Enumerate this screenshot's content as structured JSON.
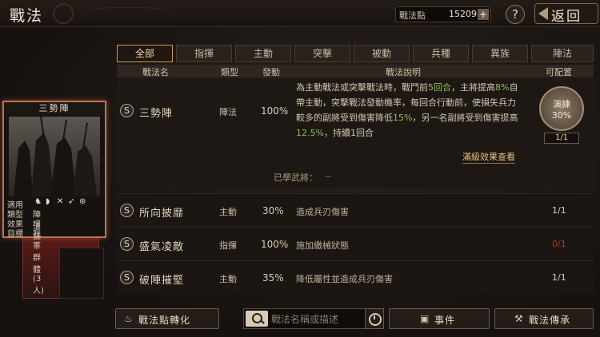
{
  "header": {
    "title": "戰法",
    "points_label": "戰法點",
    "points_value": "15209",
    "plus_label": "+",
    "help_label": "?",
    "back_label": "返回"
  },
  "tabs": [
    {
      "label": "全部",
      "active": true
    },
    {
      "label": "指揮"
    },
    {
      "label": "主動"
    },
    {
      "label": "突擊"
    },
    {
      "label": "被動"
    },
    {
      "label": "兵種"
    },
    {
      "label": "異族"
    },
    {
      "label": "陣法"
    }
  ],
  "table": {
    "headers": [
      "戰法名",
      "類型",
      "發動",
      "戰法說明",
      "可配置"
    ]
  },
  "featured": {
    "badge": "S",
    "name": "三勢陣",
    "type": "陣法",
    "rate": "100%",
    "desc_parts": [
      "為主動戰法或突擊戰法時，戰鬥前",
      "5回合",
      "，主將提高",
      "8%",
      "自帶主動，突擊戰法發動機率，每回合行動前，使損失兵力較多的副將受到傷害降低",
      "15%",
      "，另一名副將受到傷害提高",
      "12.5%",
      "，持續1回合"
    ],
    "full_effect_link": "滿級效果查看",
    "learned_label": "已學武將：",
    "learned_value": "--",
    "train_label": "演練",
    "train_pct": "30%",
    "train_count": "1/1"
  },
  "rows": [
    {
      "badge": "S",
      "name": "所向披靡",
      "type": "主動",
      "rate": "30%",
      "desc": "造成兵刃傷害",
      "avail": "1/1",
      "avail_red": false
    },
    {
      "badge": "S",
      "name": "盛氣凌敵",
      "type": "指揮",
      "rate": "100%",
      "desc": "施加繳械狀態",
      "avail": "0/1",
      "avail_red": true
    },
    {
      "badge": "S",
      "name": "破陣摧堅",
      "type": "主動",
      "rate": "35%",
      "desc": "降低屬性並造成兵刃傷害",
      "avail": "1/1",
      "avail_red": false
    }
  ],
  "card": {
    "title": "三勢陣",
    "props": [
      {
        "k": "適用",
        "v": ""
      },
      {
        "k": "類型",
        "v": "陣法"
      },
      {
        "k": "效果",
        "v": "增益"
      },
      {
        "k": "目標",
        "v": "我軍群體(3人)"
      }
    ],
    "unit_icons": [
      "cavalry-icon",
      "shield-icon",
      "crossbow-icon",
      "spear-icon",
      "siege-icon"
    ]
  },
  "bottom": {
    "convert_label": "戰法點轉化",
    "search_placeholder": "戰法名稱或描述",
    "event_label": "事件",
    "inherit_label": "戰法傳承"
  },
  "colors": {
    "accent": "#d39a4a",
    "highlight_green": "#8fbf4e",
    "warn_red": "#a83a2a"
  }
}
